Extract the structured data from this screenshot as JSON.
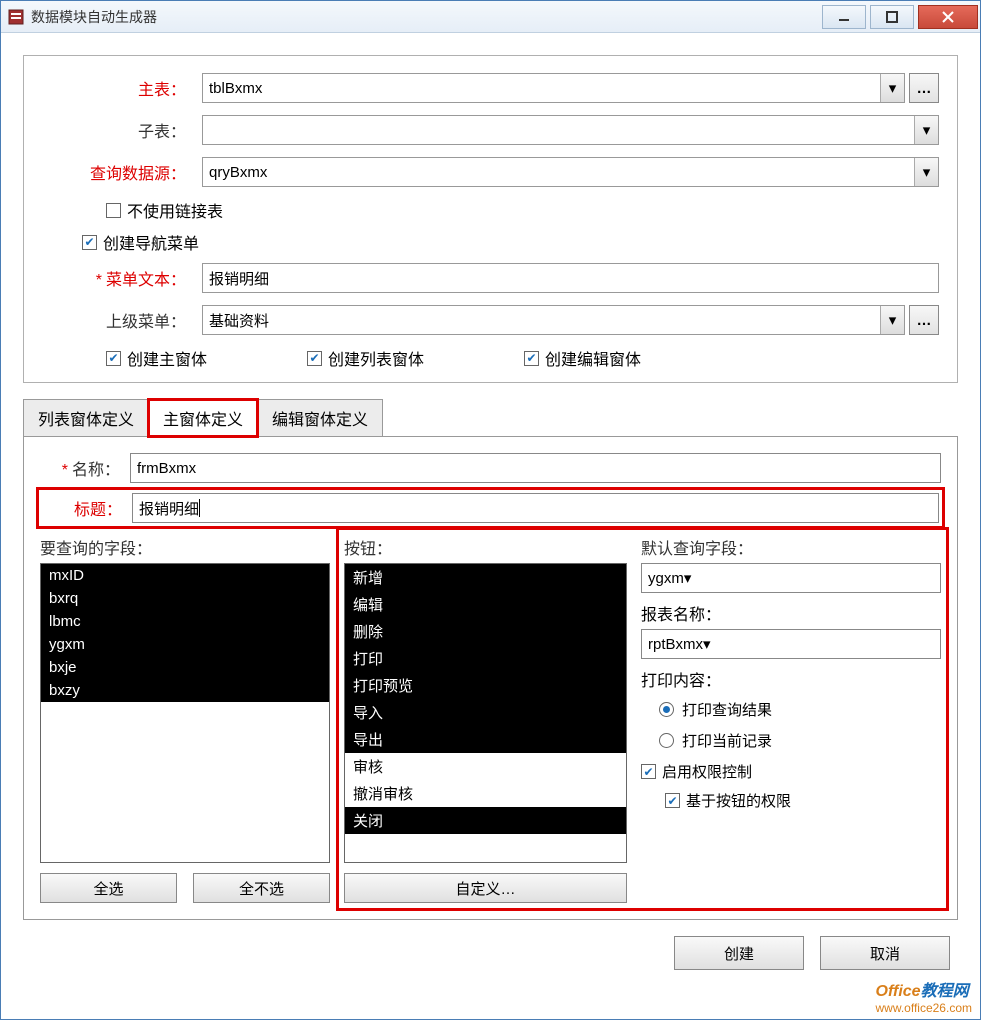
{
  "window": {
    "title": "数据模块自动生成器"
  },
  "upper": {
    "main_table_label": "主表：",
    "main_table_value": "tblBxmx",
    "sub_table_label": "子表：",
    "sub_table_value": "",
    "datasource_label": "查询数据源：",
    "datasource_value": "qryBxmx",
    "no_link_table_label": "不使用链接表",
    "no_link_table_checked": false,
    "create_nav_label": "创建导航菜单",
    "create_nav_checked": true,
    "menu_text_label": "菜单文本：",
    "menu_text_value": "报销明细",
    "parent_menu_label": "上级菜单：",
    "parent_menu_value": "基础资料",
    "create_main_form_label": "创建主窗体",
    "create_main_form_checked": true,
    "create_list_form_label": "创建列表窗体",
    "create_list_form_checked": true,
    "create_edit_form_label": "创建编辑窗体",
    "create_edit_form_checked": true
  },
  "tabs": {
    "list_def": "列表窗体定义",
    "main_def": "主窗体定义",
    "edit_def": "编辑窗体定义",
    "active": "main_def"
  },
  "main_def": {
    "name_label": "名称：",
    "name_value": "frmBxmx",
    "title_label": "标题：",
    "title_value": "报销明细",
    "query_fields_label": "要查询的字段：",
    "query_fields": [
      "mxID",
      "bxrq",
      "lbmc",
      "ygxm",
      "bxje",
      "bxzy"
    ],
    "query_fields_selected": [
      0,
      1,
      2,
      3,
      4,
      5
    ],
    "select_all": "全选",
    "select_none": "全不选",
    "buttons_label": "按钮：",
    "buttons": [
      "新增",
      "编辑",
      "删除",
      "打印",
      "打印预览",
      "导入",
      "导出",
      "审核",
      "撤消审核",
      "关闭"
    ],
    "buttons_selected": [
      0,
      1,
      2,
      3,
      4,
      5,
      6,
      9
    ],
    "customize": "自定义…",
    "default_query_field_label": "默认查询字段：",
    "default_query_field_value": "ygxm",
    "report_name_label": "报表名称：",
    "report_name_value": "rptBxmx",
    "print_content_label": "打印内容：",
    "print_query_result": "打印查询结果",
    "print_current_record": "打印当前记录",
    "print_selected": "query_result",
    "enable_permission_label": "启用权限控制",
    "enable_permission_checked": true,
    "button_based_permission_label": "基于按钮的权限",
    "button_based_permission_checked": true
  },
  "footer": {
    "create": "创建",
    "cancel": "取消"
  },
  "watermark": {
    "brand1": "Office",
    "brand2": "教程网",
    "url": "www.office26.com"
  }
}
